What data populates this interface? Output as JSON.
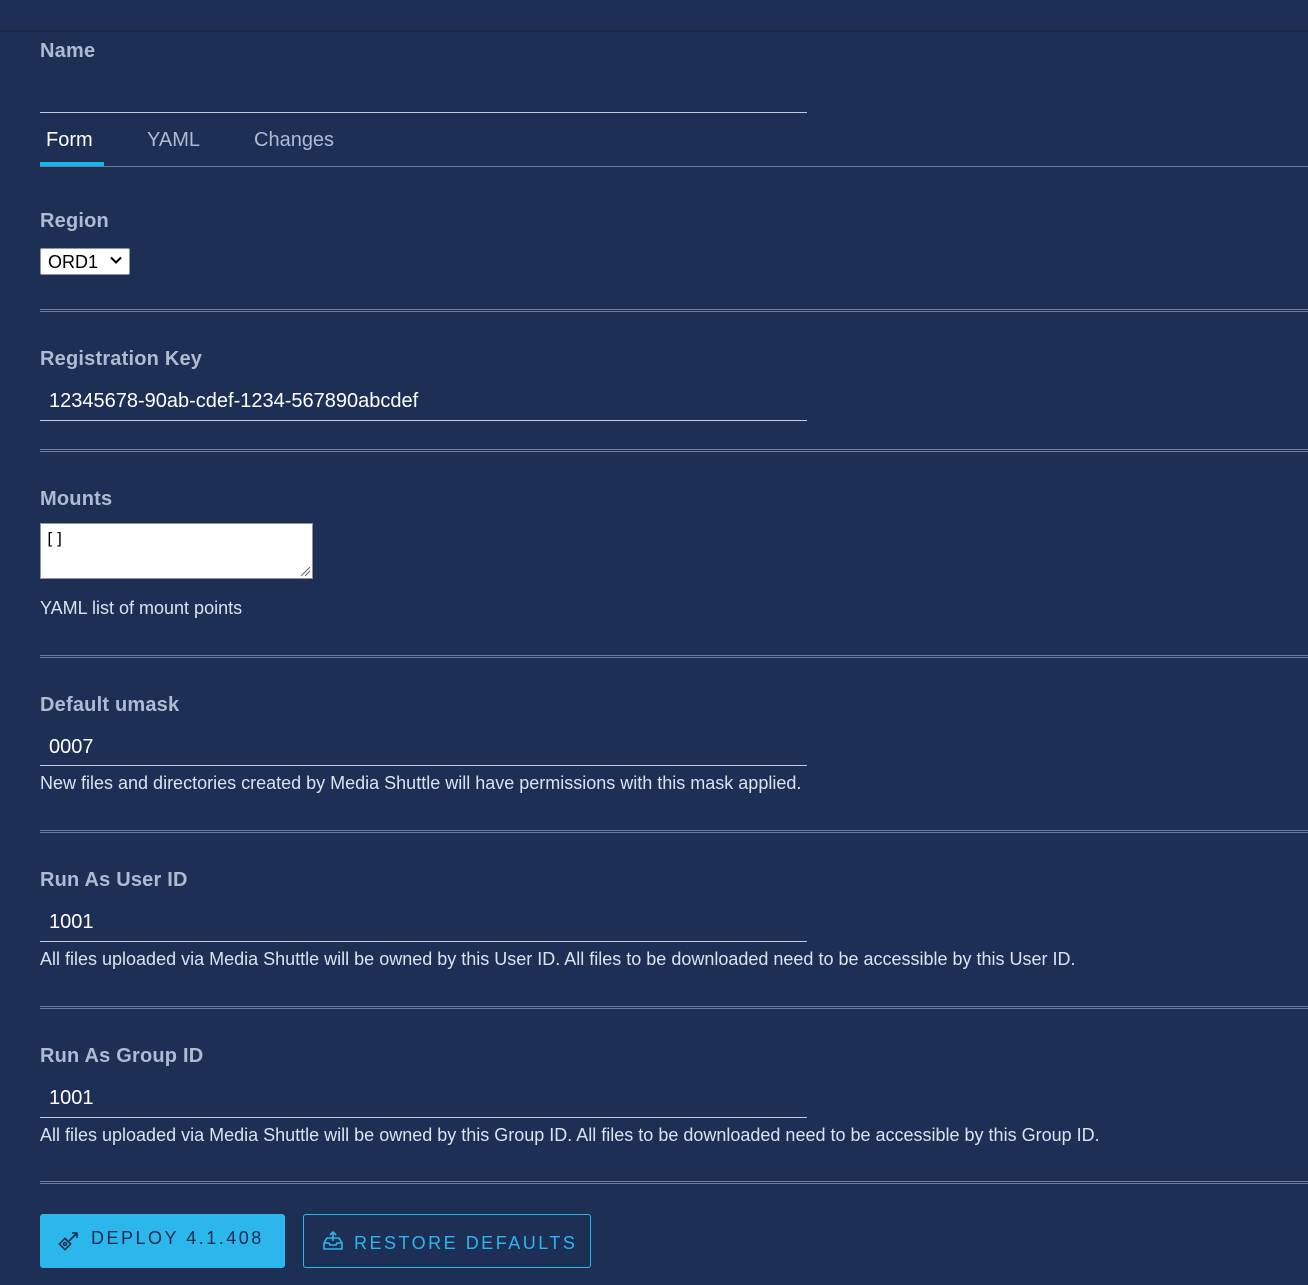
{
  "form": {
    "name_label": "Name",
    "name_value": "",
    "tabs": [
      {
        "label": "Form"
      },
      {
        "label": "YAML"
      },
      {
        "label": "Changes"
      }
    ],
    "region": {
      "label": "Region",
      "selected": "ORD1"
    },
    "registration_key": {
      "label": "Registration Key",
      "value": "12345678-90ab-cdef-1234-567890abcdef"
    },
    "mounts": {
      "label": "Mounts",
      "value": "[]",
      "help": "YAML list of mount points"
    },
    "umask": {
      "label": "Default umask",
      "value": "0007",
      "help": "New files and directories created by Media Shuttle will have permissions with this mask applied."
    },
    "run_as_user": {
      "label": "Run As User ID",
      "value": "1001",
      "help": "All files uploaded via Media Shuttle will be owned by this User ID. All files to be downloaded need to be accessible by this User ID."
    },
    "run_as_group": {
      "label": "Run As Group ID",
      "value": "1001",
      "help": "All files uploaded via Media Shuttle will be owned by this Group ID. All files to be downloaded need to be accessible by this Group ID."
    }
  },
  "actions": {
    "deploy_label": "DEPLOY 4.1.408",
    "deploy_icon": "rocket-icon",
    "restore_label": "RESTORE DEFAULTS",
    "restore_icon": "upload-tray-icon"
  },
  "colors": {
    "background": "#1e2f55",
    "accent": "#2bb6ec",
    "label": "#aebbd1"
  }
}
